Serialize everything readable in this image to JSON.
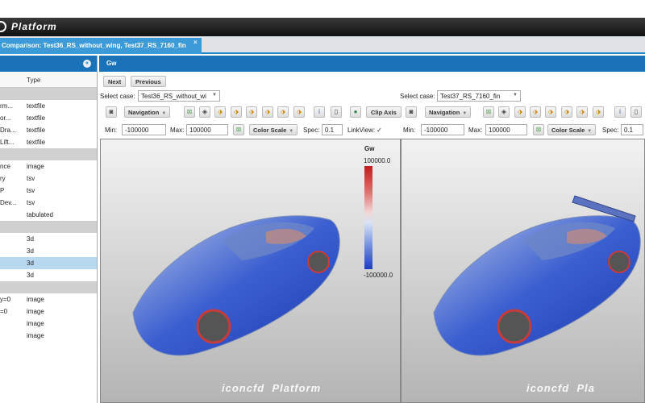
{
  "app": {
    "logo_text": "Platform"
  },
  "tab": {
    "title": "Comparison: Test36_RS_without_wing, Test37_RS_7160_fin",
    "close": "×"
  },
  "left_panel": {
    "collapse_icon": "«",
    "column_header": "Type",
    "rows": [
      {
        "kind": "group",
        "c1": "",
        "c2": ""
      },
      {
        "kind": "row",
        "c1": "rm...",
        "c2": "textfile"
      },
      {
        "kind": "row",
        "c1": "or...",
        "c2": "textfile"
      },
      {
        "kind": "row",
        "c1": "Dra...",
        "c2": "textfile"
      },
      {
        "kind": "row",
        "c1": "Lift...",
        "c2": "textfile"
      },
      {
        "kind": "group",
        "c1": "",
        "c2": ""
      },
      {
        "kind": "row",
        "c1": "nce",
        "c2": "image"
      },
      {
        "kind": "row",
        "c1": "ry",
        "c2": "tsv"
      },
      {
        "kind": "row",
        "c1": "P",
        "c2": "tsv"
      },
      {
        "kind": "row",
        "c1": "Dev...",
        "c2": "tsv"
      },
      {
        "kind": "row",
        "c1": "",
        "c2": "tabulated"
      },
      {
        "kind": "group",
        "c1": "",
        "c2": ""
      },
      {
        "kind": "row",
        "c1": "",
        "c2": "3d"
      },
      {
        "kind": "row",
        "c1": "",
        "c2": "3d"
      },
      {
        "kind": "sel",
        "c1": "",
        "c2": "3d"
      },
      {
        "kind": "row",
        "c1": "",
        "c2": "3d"
      },
      {
        "kind": "group",
        "c1": "",
        "c2": ""
      },
      {
        "kind": "row",
        "c1": "y=0",
        "c2": "image"
      },
      {
        "kind": "row",
        "c1": "=0",
        "c2": "image"
      },
      {
        "kind": "row",
        "c1": "",
        "c2": "image"
      },
      {
        "kind": "row",
        "c1": "",
        "c2": "image"
      }
    ]
  },
  "main": {
    "title": "Gw",
    "next_label": "Next",
    "previous_label": "Previous",
    "select_case_label": "Select case:",
    "left_case": "Test36_RS_without_wi",
    "right_case": "Test37_RS_7160_fin",
    "navigation_label": "Navigation",
    "clip_axis_label": "Clip Axis",
    "min_label": "Min:",
    "max_label": "Max:",
    "min_value": "-100000",
    "max_value": "100000",
    "color_scale_label": "Color Scale",
    "spec_label": "Spec:",
    "spec_value": "0.1",
    "linkview_label": "LinkView:",
    "linkview_check": "✓"
  },
  "legend": {
    "title": "Gw",
    "max": "100000.0",
    "min": "-100000.0"
  },
  "watermark": {
    "brand": "iconcfd",
    "text": "Platform",
    "text_clipped": "Pla"
  }
}
